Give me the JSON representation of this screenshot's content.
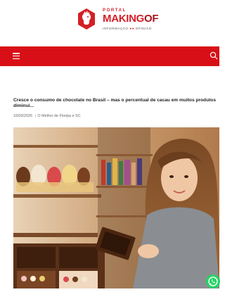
{
  "header": {
    "logo": {
      "small": "PORTAL",
      "brand_a": "MAKING",
      "brand_b": "OF",
      "tag_a": "INFORMAÇÃO",
      "tag_dots": "●●",
      "tag_b": "OPINIÃO"
    }
  },
  "navbar": {
    "menu_icon": "hamburger-menu-icon",
    "search_icon": "search-icon",
    "color": "#d80f16"
  },
  "article": {
    "title": "Cresce o consumo de chocolate no Brasil – mas o percentual de cacau em muitos produtos diminui...",
    "date": "16/03/2026",
    "separator": "|",
    "author": "O Melhor de Floripa e SC",
    "image_icon": "hero-photo"
  },
  "whatsapp": {
    "icon": "whatsapp-icon",
    "color": "#25d366"
  }
}
